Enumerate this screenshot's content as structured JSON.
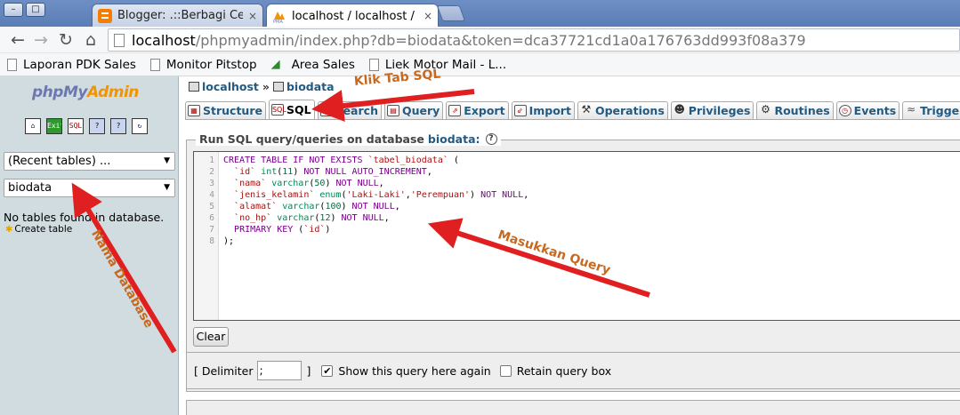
{
  "browser": {
    "window_buttons": [
      "–",
      "□"
    ],
    "tabs": [
      {
        "title": "Blogger: .::Berbagi Cerit",
        "close": "×",
        "active": false
      },
      {
        "title": "localhost / localhost / bi",
        "close": "×",
        "active": true
      }
    ],
    "address": {
      "host": "localhost",
      "path": "/phpmyadmin/index.php?db=biodata&token=dca37721cd1a0a176763dd993f08a379"
    },
    "bookmarks": [
      "Laporan PDK Sales",
      "Monitor Pitstop",
      "Area Sales",
      "Liek Motor Mail - L..."
    ]
  },
  "left": {
    "logo_php": "php",
    "logo_my": "My",
    "logo_admin": "Admin",
    "icons": [
      "home-icon",
      "exit-icon",
      "sql-icon",
      "query-window-icon",
      "docs-icon",
      "reload-icon"
    ],
    "icon_glyphs": [
      "⌂",
      "Exit",
      "SQL",
      "?",
      "?",
      "↻"
    ],
    "recent_tables": "(Recent tables) ...",
    "database_select": "biodata",
    "no_tables": "No tables found in database.",
    "create_table": "Create table"
  },
  "main": {
    "breadcrumb": {
      "server": "localhost",
      "separator": "»",
      "database": "biodata"
    },
    "tabs": [
      {
        "label": "Structure",
        "icon": "structure-icon",
        "glyph": "▦",
        "active": false
      },
      {
        "label": "SQL",
        "icon": "sql-icon",
        "glyph": "SQL",
        "active": true
      },
      {
        "label": "Search",
        "icon": "search-icon",
        "glyph": "⌕",
        "active": false
      },
      {
        "label": "Query",
        "icon": "query-icon",
        "glyph": "▤",
        "active": false
      },
      {
        "label": "Export",
        "icon": "export-icon",
        "glyph": "⇗",
        "active": false
      },
      {
        "label": "Import",
        "icon": "import-icon",
        "glyph": "⇙",
        "active": false
      },
      {
        "label": "Operations",
        "icon": "operations-icon",
        "glyph": "⚒",
        "active": false
      },
      {
        "label": "Privileges",
        "icon": "privileges-icon",
        "glyph": "☻",
        "active": false
      },
      {
        "label": "Routines",
        "icon": "routines-icon",
        "glyph": "⚙",
        "active": false
      },
      {
        "label": "Events",
        "icon": "events-icon",
        "glyph": "◷",
        "active": false
      },
      {
        "label": "Triggers",
        "icon": "triggers-icon",
        "glyph": "≈",
        "active": false
      }
    ],
    "legend_text": "Run SQL query/queries on database",
    "legend_db": "biodata:",
    "help": "?",
    "line_numbers": [
      "1",
      "2",
      "3",
      "4",
      "5",
      "6",
      "7",
      "8"
    ],
    "clear_button": "Clear",
    "delimiter_label_open": "[ Delimiter",
    "delimiter_value": ";",
    "delimiter_label_close": "]",
    "show_query_label": "Show this query here again",
    "show_query_checked": true,
    "retain_label": "Retain query box",
    "retain_checked": false
  },
  "annotations": {
    "tab_sql": "Klik Tab SQL",
    "query": "Masukkan Query",
    "database": "Nama Database",
    "arrow_color": "#e02020",
    "text_color": "#c8691e"
  }
}
